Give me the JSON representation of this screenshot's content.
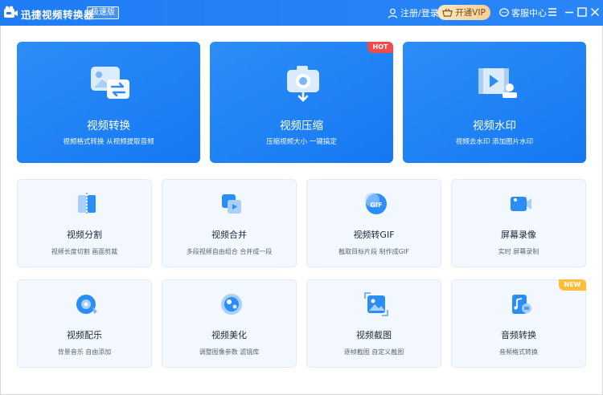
{
  "titlebar": {
    "app_title": "迅捷视频转换器",
    "speed_badge": "极速版",
    "login": "注册/登录",
    "vip": "开通VIP",
    "service": "客服中心"
  },
  "tags": {
    "hot": "HOT",
    "new": "NEW"
  },
  "big_tools": [
    {
      "name": "视频转换",
      "desc": "视频格式转换 从视频提取音频",
      "icon": "video-convert-icon"
    },
    {
      "name": "视频压缩",
      "desc": "压缩视频大小 一键搞定",
      "icon": "video-compress-icon"
    },
    {
      "name": "视频水印",
      "desc": "视频去水印 添加图片水印",
      "icon": "video-watermark-icon"
    }
  ],
  "small_tools": [
    {
      "name": "视频分割",
      "desc": "视频长度切割 画面剪裁",
      "icon": "video-split-icon"
    },
    {
      "name": "视频合并",
      "desc": "多段视频自由组合 合并成一段",
      "icon": "video-merge-icon"
    },
    {
      "name": "视频转GIF",
      "desc": "截取目标片段 制作成GIF",
      "icon": "gif-icon"
    },
    {
      "name": "屏幕录像",
      "desc": "实时 屏幕录制",
      "icon": "screen-record-icon"
    },
    {
      "name": "视频配乐",
      "desc": "背景音乐 自由添加",
      "icon": "music-icon"
    },
    {
      "name": "视频美化",
      "desc": "调整图像参数 滤镜库",
      "icon": "beautify-icon"
    },
    {
      "name": "视频截图",
      "desc": "逐帧截图 自定义截图",
      "icon": "screenshot-icon"
    },
    {
      "name": "音频转换",
      "desc": "音频格式转换",
      "icon": "audio-convert-icon"
    }
  ],
  "colors": {
    "brand": "#1f7cf5",
    "hot": "#f04b4b",
    "new": "#ffbd3a",
    "card_bg": "#f3f8fe"
  }
}
